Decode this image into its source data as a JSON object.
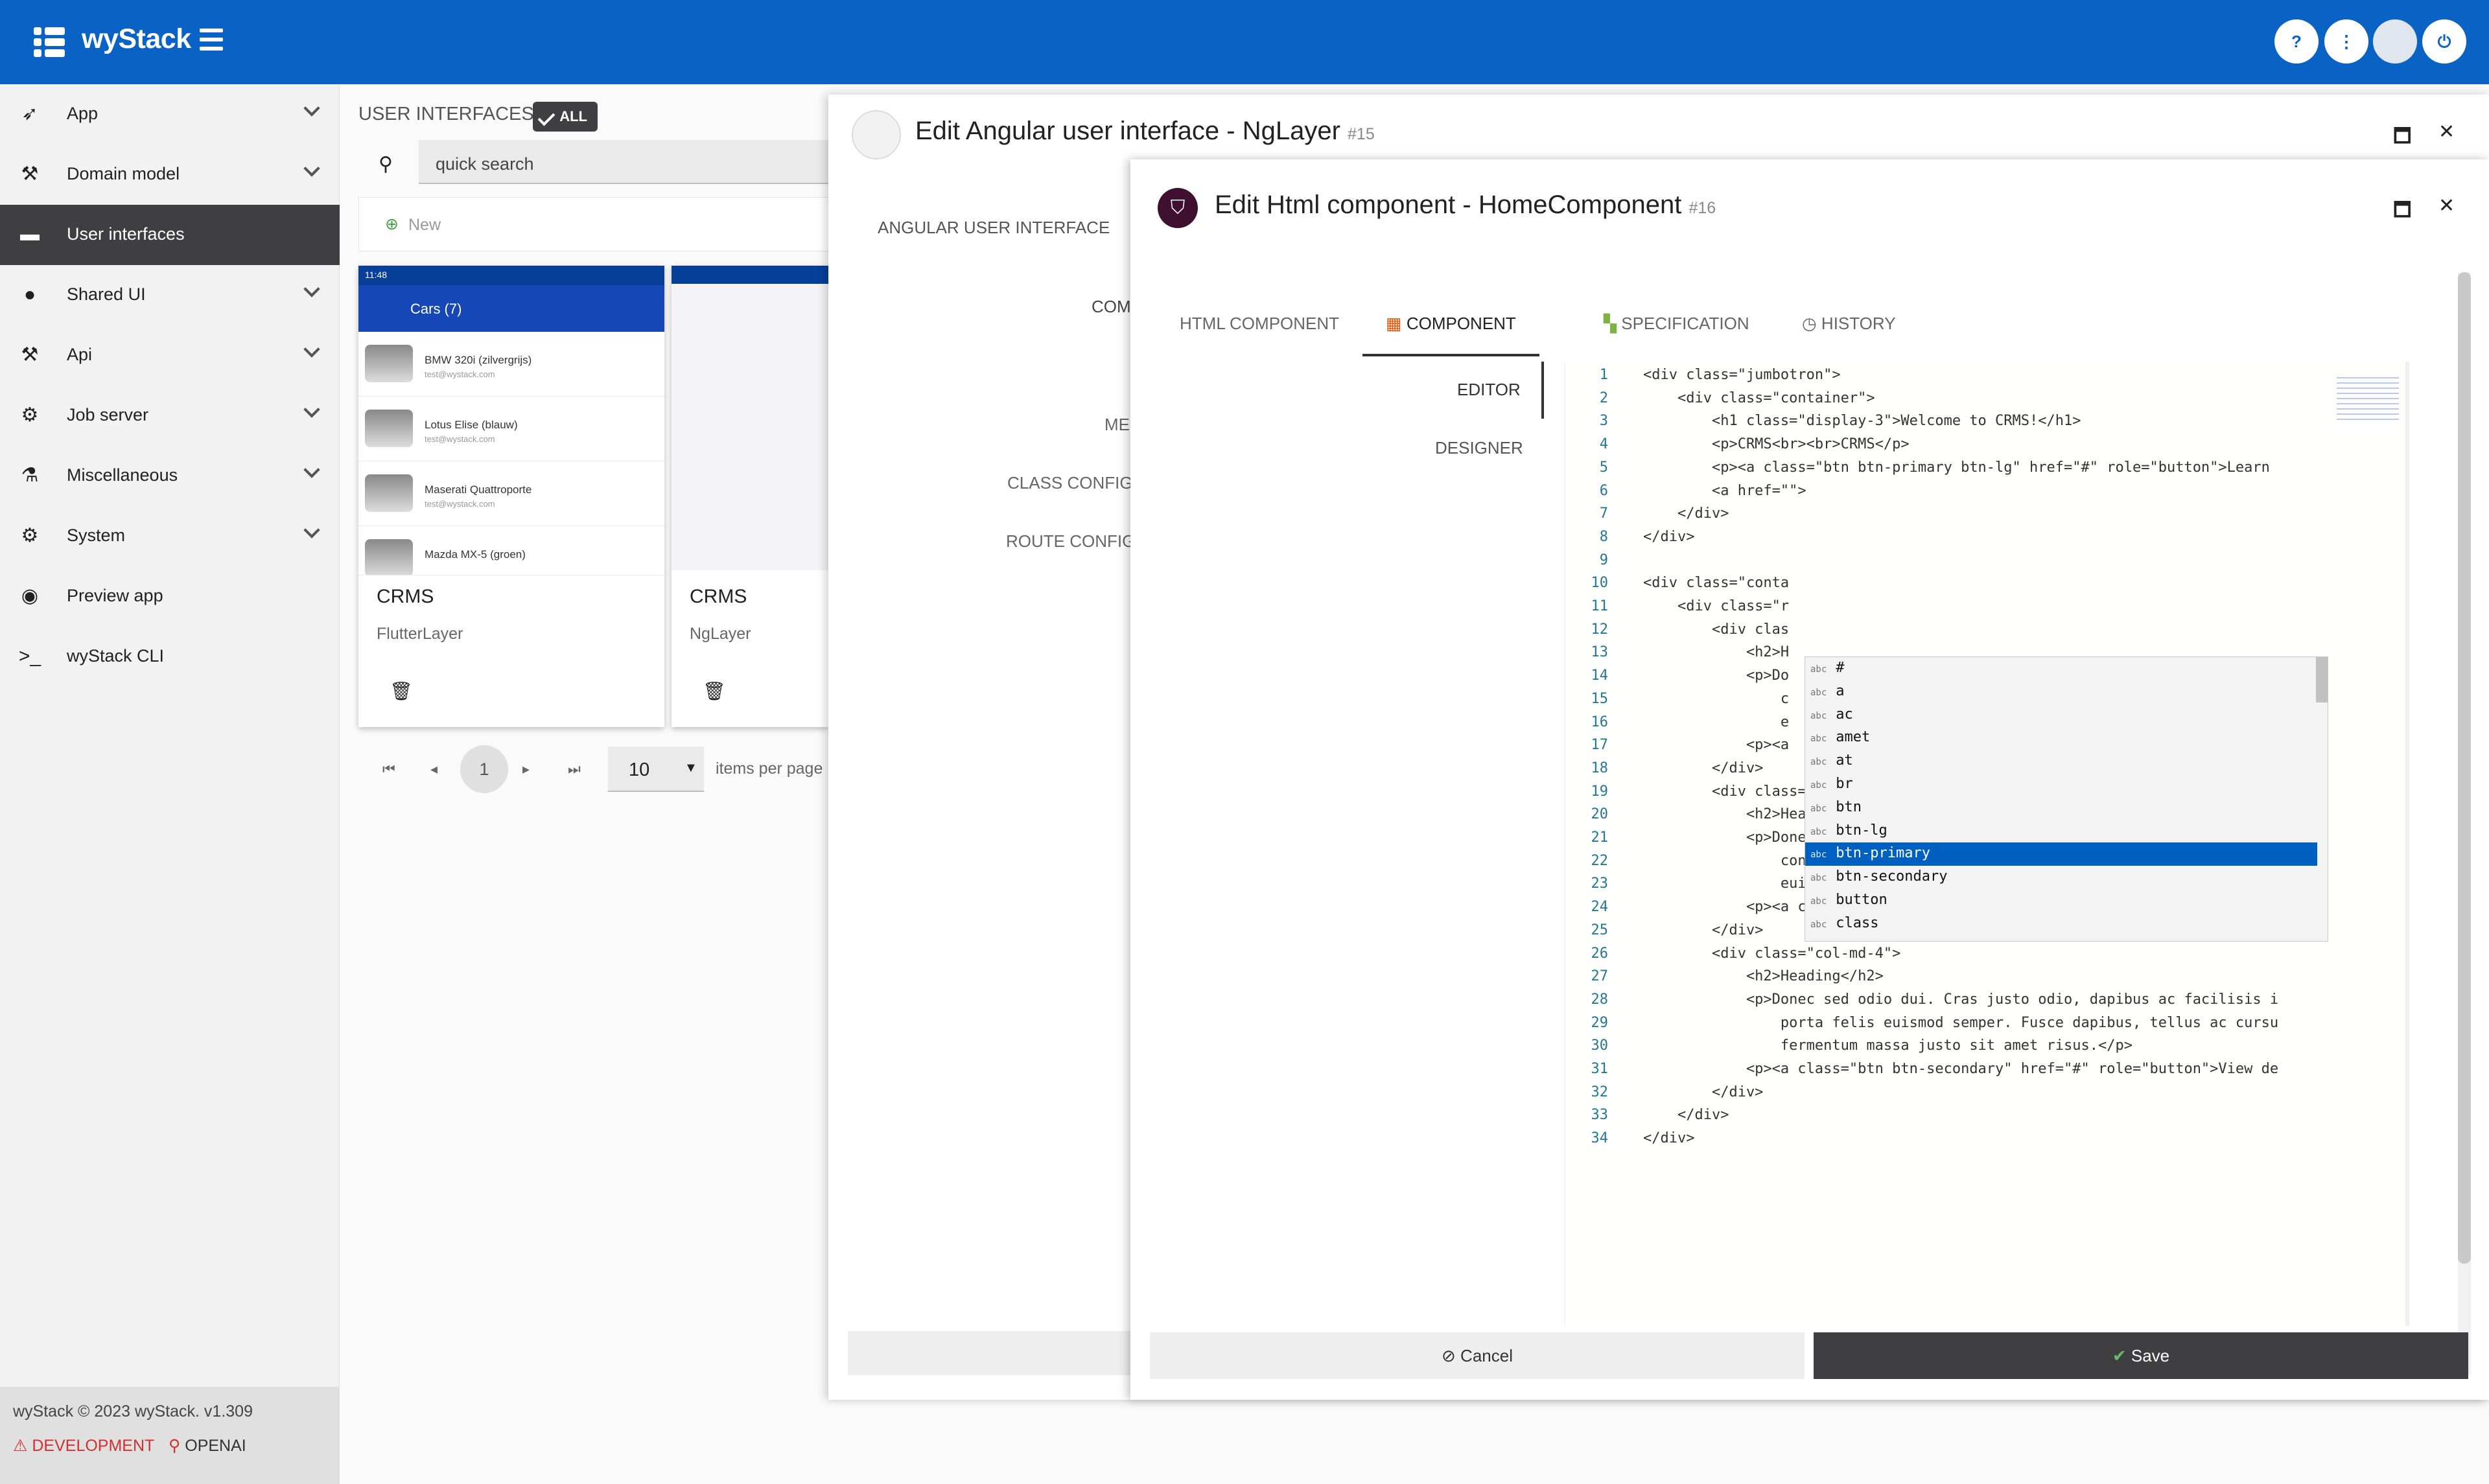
{
  "app": {
    "title": "wyStack",
    "footer": "wyStack © 2023 wyStack. v1.309",
    "env": "DEVELOPMENT",
    "ai": "OPENAI"
  },
  "sidebar": {
    "items": [
      {
        "label": "App",
        "icon": "rocket-icon"
      },
      {
        "label": "Domain model",
        "icon": "wrench-icon"
      },
      {
        "label": "User interfaces",
        "icon": "window-icon"
      },
      {
        "label": "Shared UI",
        "icon": "person-icon"
      },
      {
        "label": "Api",
        "icon": "hammer-icon"
      },
      {
        "label": "Job server",
        "icon": "gear-icon"
      },
      {
        "label": "Miscellaneous",
        "icon": "flask-icon"
      },
      {
        "label": "System",
        "icon": "cogs-icon"
      },
      {
        "label": "Preview app",
        "icon": "eye-icon"
      },
      {
        "label": "wyStack CLI",
        "icon": "terminal-icon"
      }
    ]
  },
  "list": {
    "title": "USER INTERFACES",
    "chip": "ALL",
    "search": "quick search",
    "new_label": "New",
    "cards": [
      {
        "title": "CRMS",
        "sub": "FlutterLayer"
      },
      {
        "title": "CRMS",
        "sub": "NgLayer"
      }
    ],
    "phone": {
      "time": "11:48",
      "bar": "Cars (7)",
      "cars": [
        {
          "name": "BMW 320i (zilvergrijs)",
          "mail": "test@wystack.com"
        },
        {
          "name": "Lotus Elise (blauw)",
          "mail": "test@wystack.com"
        },
        {
          "name": "Maserati Quattroporte",
          "mail": "test@wystack.com"
        },
        {
          "name": "Mazda MX-5 (groen)",
          "mail": "test@wystack.com"
        }
      ]
    },
    "pager": {
      "page": "1",
      "per_page": "10",
      "label": "items per page"
    }
  },
  "dialog1": {
    "title": "Edit Angular user interface - NgLayer",
    "id": "#15",
    "section": "ANGULAR USER INTERFACE",
    "labels": [
      "COM",
      "ME",
      "CLASS CONFIGU",
      "ROUTE CONFIGU"
    ]
  },
  "dialog2": {
    "title": "Edit Html component - HomeComponent",
    "id": "#16",
    "tabs": [
      "HTML COMPONENT",
      "COMPONENT",
      "SPECIFICATION",
      "HISTORY"
    ],
    "side_tabs": [
      "EDITOR",
      "DESIGNER"
    ],
    "cancel": "Cancel",
    "save": "Save"
  },
  "code": [
    "<div class=\"jumbotron\">",
    "    <div class=\"container\">",
    "        <h1 class=\"display-3\">Welcome to CRMS!</h1>",
    "        <p>CRMS<br><br>CRMS</p>",
    "        <p><a class=\"btn btn-primary btn-lg\" href=\"#\" role=\"button\">Learn",
    "        <a href=\"\">",
    "    </div>",
    "</div>",
    "",
    "<div class=\"conta",
    "    <div class=\"r",
    "        <div clas",
    "            <h2>H",
    "            <p>Do",
    "                c",
    "                e",
    "            <p><a",
    "        </div>",
    "        <div class=\"col-md-4\">",
    "            <h2>Heading</h2>",
    "            <p>Donec id elit non mi porta gravida at eget metus. Fusce dap",
    "                condimentum nibh, ut fermentum massa justo sit amet risus.",
    "                euismod. Donec sed odio dui. </p>",
    "            <p><a class=\"btn btn-secondary\" href=\"#\" role=\"button\">View de",
    "        </div>",
    "        <div class=\"col-md-4\">",
    "            <h2>Heading</h2>",
    "            <p>Donec sed odio dui. Cras justo odio, dapibus ac facilisis i",
    "                porta felis euismod semper. Fusce dapibus, tellus ac cursu",
    "                fermentum massa justo sit amet risus.</p>",
    "            <p><a class=\"btn btn-secondary\" href=\"#\" role=\"button\">View de",
    "        </div>",
    "    </div>",
    "</div>"
  ],
  "suggestions": [
    "#",
    "a",
    "ac",
    "amet",
    "at",
    "br",
    "btn",
    "btn-lg",
    "btn-primary",
    "btn-secondary",
    "button",
    "class"
  ],
  "suggest_kind": "abc",
  "selected_suggestion": "btn-primary"
}
